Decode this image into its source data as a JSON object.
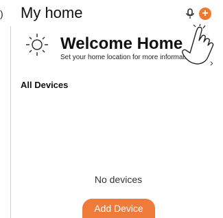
{
  "header": {
    "left_fragment": ")",
    "title": "My home",
    "mic_icon": "mic-icon",
    "add_icon": "plus-circle-icon",
    "add_symbol": "+"
  },
  "welcome": {
    "icon": "sun-icon",
    "title": "Welcome Home",
    "subtitle": "Set your home location for more information",
    "chevron": "›"
  },
  "overlay": {
    "hand_icon": "pointing-hand-icon"
  },
  "devices": {
    "section_title": "All Devices",
    "empty_text": "No devices",
    "add_button": "Add Device"
  },
  "colors": {
    "accent": "#f07a2b",
    "button": "#ee7b3a"
  }
}
